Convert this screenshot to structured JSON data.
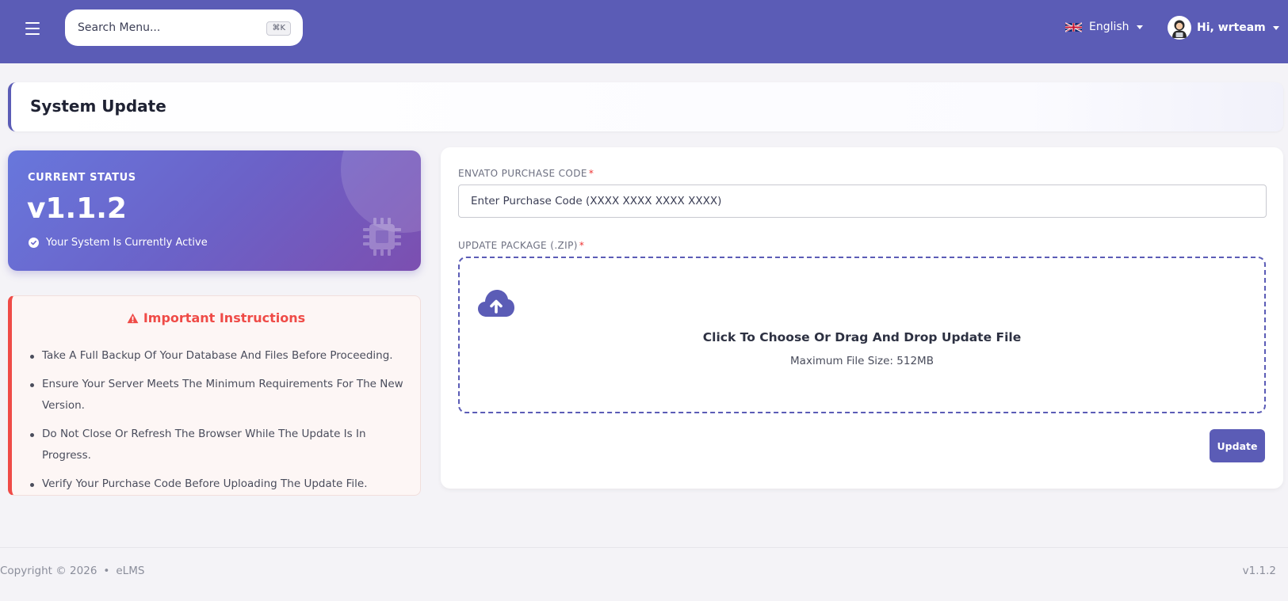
{
  "header": {
    "search": {
      "placeholder": "Search Menu...",
      "shortcut": "⌘K"
    },
    "language": {
      "label": "English",
      "flag_icon": "uk-flag-icon"
    },
    "user": {
      "greeting": "Hi, wrteam",
      "avatar_icon": "user-avatar-icon"
    },
    "menu_icon": "hamburger-icon",
    "background_color": "#5b5cb6"
  },
  "page": {
    "title": "System Update"
  },
  "status_card": {
    "label": "CURRENT STATUS",
    "version": "v1.1.2",
    "status_text": "Your System Is Currently Active",
    "icons": [
      "check-circle-icon",
      "cpu-chip-icon"
    ]
  },
  "instructions": {
    "title": "Important Instructions",
    "accent_color": "#ef4b47",
    "items": [
      "Take A Full Backup Of Your Database And Files Before Proceeding.",
      "Ensure Your Server Meets The Minimum Requirements For The New Version.",
      "Do Not Close Or Refresh The Browser While The Update Is In Progress.",
      "Verify Your Purchase Code Before Uploading The Update File."
    ]
  },
  "form": {
    "purchase_code": {
      "label": "ENVATO PURCHASE CODE",
      "required_mark": "*",
      "placeholder": "Enter Purchase Code (XXXX XXXX XXXX XXXX)",
      "value": ""
    },
    "package": {
      "label": "UPDATE PACKAGE (.ZIP)",
      "required_mark": "*",
      "dropzone_title": "Click To Choose Or Drag And Drop Update File",
      "dropzone_subtitle": "Maximum File Size: 512MB",
      "icon": "cloud-upload-icon"
    },
    "submit_label": "Update"
  },
  "footer": {
    "copyright": "Copyright © 2026",
    "separator": "•",
    "brand": "eLMS",
    "version": "v1.1.2"
  }
}
